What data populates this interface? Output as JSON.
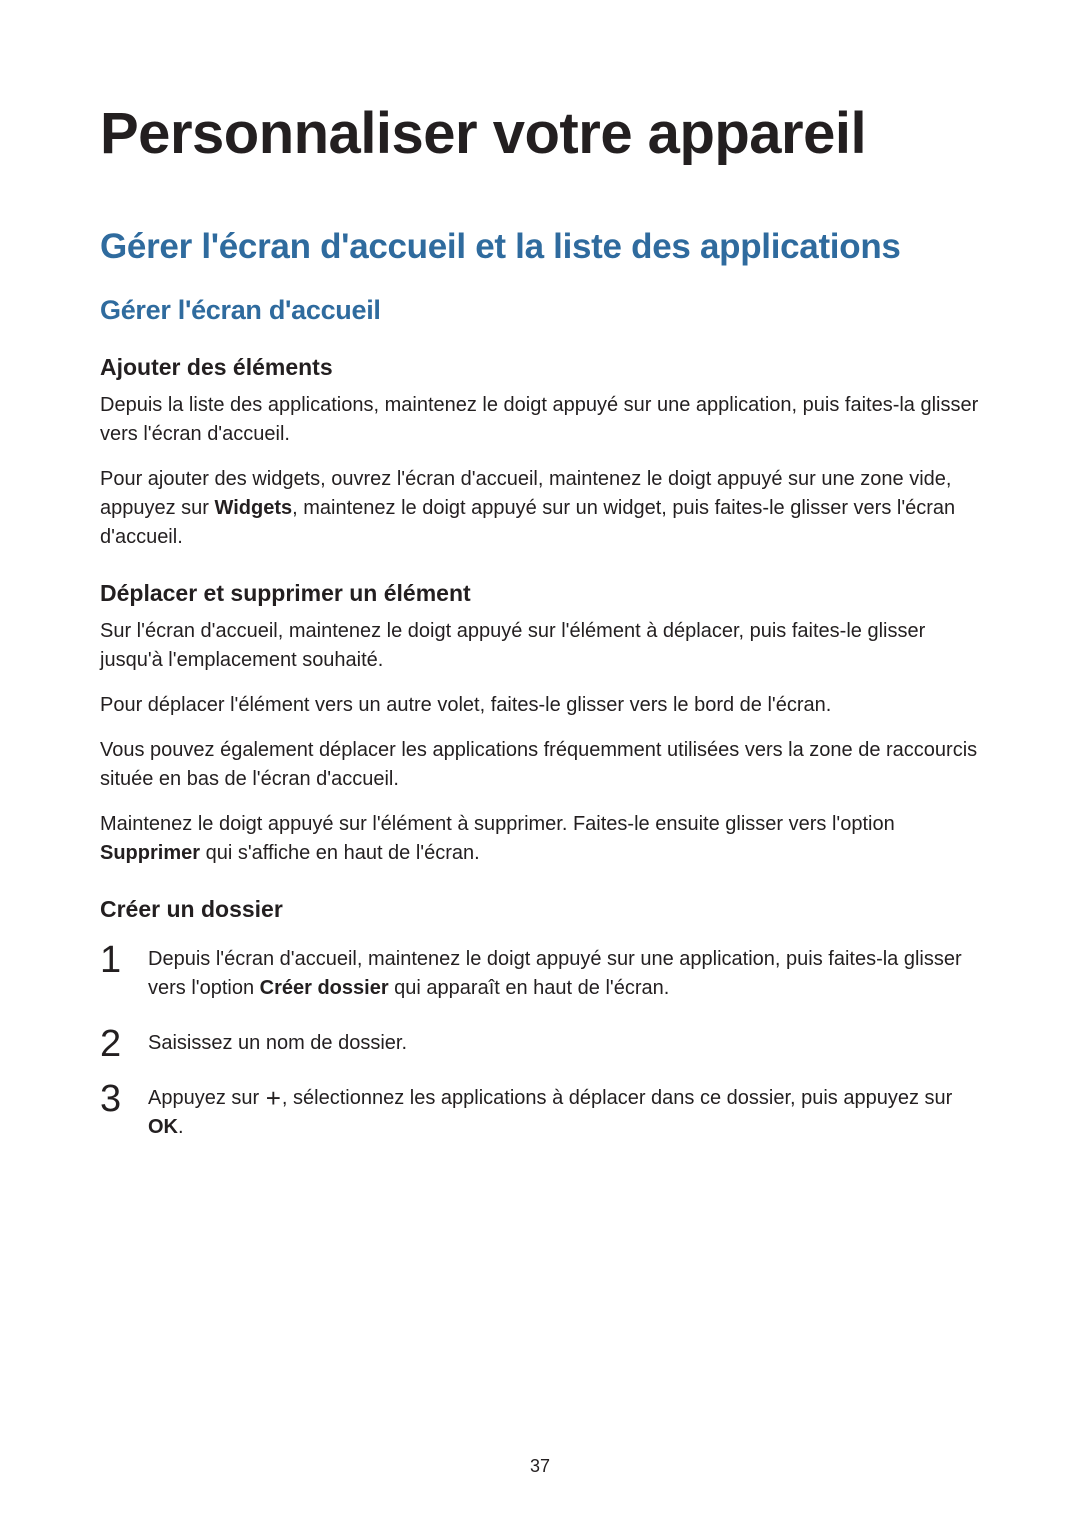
{
  "page_number": "37",
  "title": "Personnaliser votre appareil",
  "h2": "Gérer l'écran d'accueil et la liste des applications",
  "h3": "Gérer l'écran d'accueil",
  "sec1": {
    "heading": "Ajouter des éléments",
    "p1": "Depuis la liste des applications, maintenez le doigt appuyé sur une application, puis faites-la glisser vers l'écran d'accueil.",
    "p2a": "Pour ajouter des widgets, ouvrez l'écran d'accueil, maintenez le doigt appuyé sur une zone vide, appuyez sur ",
    "p2b": "Widgets",
    "p2c": ", maintenez le doigt appuyé sur un widget, puis faites-le glisser vers l'écran d'accueil."
  },
  "sec2": {
    "heading": "Déplacer et supprimer un élément",
    "p1": "Sur l'écran d'accueil, maintenez le doigt appuyé sur l'élément à déplacer, puis faites-le glisser jusqu'à l'emplacement souhaité.",
    "p2": "Pour déplacer l'élément vers un autre volet, faites-le glisser vers le bord de l'écran.",
    "p3": "Vous pouvez également déplacer les applications fréquemment utilisées vers la zone de raccourcis située en bas de l'écran d'accueil.",
    "p4a": "Maintenez le doigt appuyé sur l'élément à supprimer. Faites-le ensuite glisser vers l'option ",
    "p4b": "Supprimer",
    "p4c": " qui s'affiche en haut de l'écran."
  },
  "sec3": {
    "heading": "Créer un dossier",
    "step1a": "Depuis l'écran d'accueil, maintenez le doigt appuyé sur une application, puis faites-la glisser vers l'option ",
    "step1b": "Créer dossier",
    "step1c": " qui apparaît en haut de l'écran.",
    "step2": "Saisissez un nom de dossier.",
    "step3a": "Appuyez sur ",
    "step3_icon": "+",
    "step3b": ", sélectionnez les applications à déplacer dans ce dossier, puis appuyez sur ",
    "step3c": "OK",
    "step3d": "."
  }
}
